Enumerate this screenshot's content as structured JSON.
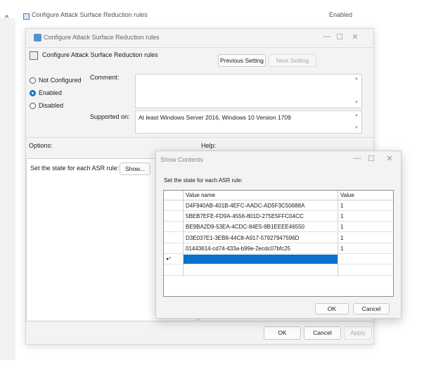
{
  "background": {
    "row_label": "Configure Attack Surface Reduction rules",
    "row_state": "Enabled"
  },
  "main_dialog": {
    "title": "Configure Attack Surface Reduction rules",
    "policy_name": "Configure Attack Surface Reduction rules",
    "previous_setting_label": "Previous Setting",
    "next_setting_label": "Next Setting",
    "radio_not_configured": "Not Configured",
    "radio_enabled": "Enabled",
    "radio_disabled": "Disabled",
    "selected_state": "Enabled",
    "comment_label": "Comment:",
    "supported_on_label": "Supported on:",
    "supported_on_value": "At least Windows Server 2016, Windows 10 Version 1709",
    "options_label": "Options:",
    "help_label": "Help:",
    "asr_option_label": "Set the state for each ASR rule:",
    "show_button_label": "Show...",
    "ok_label": "OK",
    "cancel_label": "Cancel",
    "apply_label": "Apply"
  },
  "show_contents": {
    "title": "Show Contents",
    "instruction": "Set the state for each ASR rule:",
    "columns": [
      "Value name",
      "Value"
    ],
    "rows": [
      {
        "name": "D4F940AB-401B-4EFC-AADC-AD5F3C50688A",
        "value": "1"
      },
      {
        "name": "5BEB7EFE-FD9A-4556-801D-275E5FFC04CC",
        "value": "1"
      },
      {
        "name": "BE9BA2D9-53EA-4CDC-84E5-9B1EEEE46550",
        "value": "1"
      },
      {
        "name": "D3E037E1-3EB8-44C8-A917-57927947596D",
        "value": "1"
      },
      {
        "name": "01443614-cd74-433a-b99e-2ecdc07bfc25",
        "value": "1"
      }
    ],
    "new_row_marker": "▸*",
    "ok_label": "OK",
    "cancel_label": "Cancel"
  },
  "colors": {
    "accent": "#0a6fcd",
    "dialog_bg": "#f3f3f3"
  },
  "icons": {
    "collapse": "caret-up-icon",
    "policy": "policy-setting-icon",
    "minimize": "minimize-icon",
    "maximize": "maximize-icon",
    "close": "close-icon"
  }
}
